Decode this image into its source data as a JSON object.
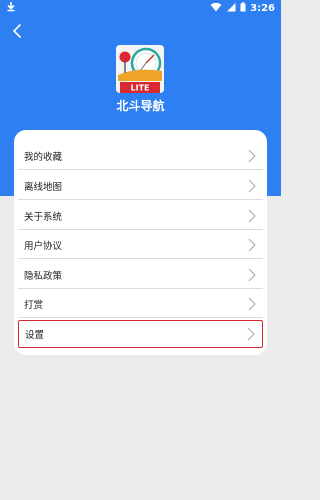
{
  "status_bar": {
    "time": "3:26",
    "icons": [
      "download-icon",
      "wifi-icon",
      "signal-icon",
      "battery-icon"
    ]
  },
  "header": {
    "back_icon": "back-arrow-icon",
    "app_icon_badge": "LITE",
    "app_name": "北斗导航"
  },
  "menu": {
    "items": [
      {
        "label": "我的收藏"
      },
      {
        "label": "离线地图"
      },
      {
        "label": "关于系统"
      },
      {
        "label": "用户协议"
      },
      {
        "label": "隐私政策"
      },
      {
        "label": "打赏"
      },
      {
        "label": "设置"
      }
    ]
  },
  "colors": {
    "header_bg": "#2e7ff2",
    "page_bg": "#ececec",
    "highlight_border": "#d9282f"
  }
}
